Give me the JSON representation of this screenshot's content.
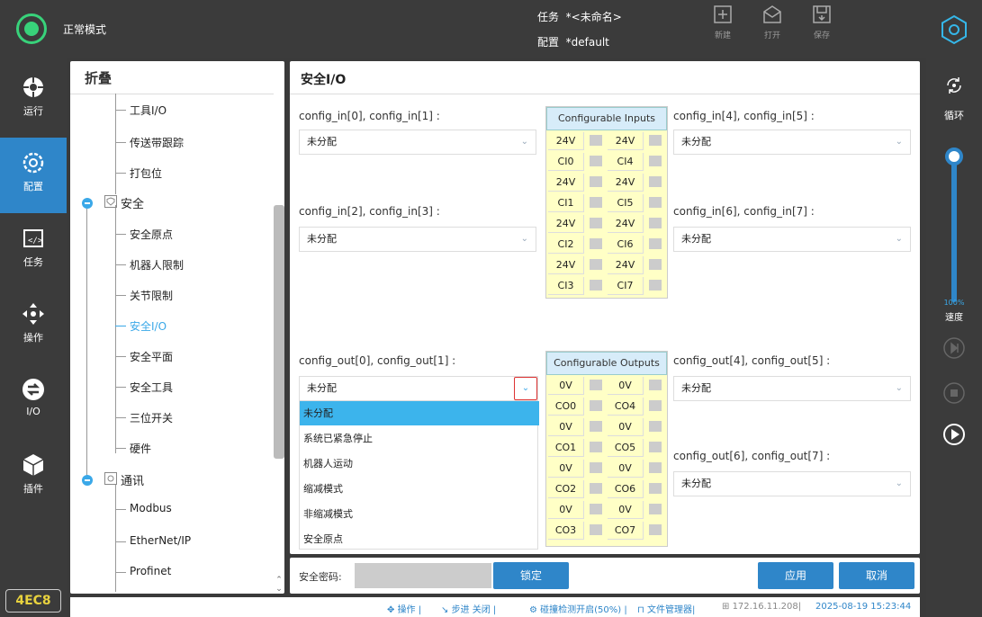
{
  "topbar": {
    "mode": "正常模式",
    "task_label": "任务",
    "task_value": "*<未命名>",
    "config_label": "配置",
    "config_value": "*default",
    "new_label": "新建",
    "open_label": "打开",
    "save_label": "保存"
  },
  "leftnav": {
    "items": [
      {
        "label": "运行",
        "icon": "run-icon"
      },
      {
        "label": "配置",
        "icon": "config-icon"
      },
      {
        "label": "任务",
        "icon": "task-icon"
      },
      {
        "label": "操作",
        "icon": "move-icon"
      },
      {
        "label": "I/O",
        "icon": "io-icon"
      },
      {
        "label": "插件",
        "icon": "plugin-icon"
      }
    ],
    "badge": "4EC8"
  },
  "rightbar": {
    "loop_label": "循环",
    "speed_value": "100%",
    "speed_label": "速度"
  },
  "tree": {
    "title": "折叠",
    "items": [
      "工具I/O",
      "传送带跟踪",
      "打包位",
      "安全",
      "安全原点",
      "机器人限制",
      "关节限制",
      "安全I/O",
      "安全平面",
      "安全工具",
      "三位开关",
      "硬件",
      "通讯",
      "Modbus",
      "EtherNet/IP",
      "Profinet"
    ]
  },
  "main": {
    "title": "安全I/O",
    "in_labels": [
      "config_in[0], config_in[1] :",
      "config_in[2], config_in[3] :",
      "config_in[4], config_in[5] :",
      "config_in[6], config_in[7] :"
    ],
    "out_labels": [
      "config_out[0], config_out[1] :",
      "config_out[4], config_out[5] :",
      "config_out[6], config_out[7] :"
    ],
    "unassigned": "未分配",
    "inputs_header": "Configurable Inputs",
    "outputs_header": "Configurable Outputs",
    "inputs_rows": [
      [
        "24V",
        "24V"
      ],
      [
        "CI0",
        "CI4"
      ],
      [
        "24V",
        "24V"
      ],
      [
        "CI1",
        "CI5"
      ],
      [
        "24V",
        "24V"
      ],
      [
        "CI2",
        "CI6"
      ],
      [
        "24V",
        "24V"
      ],
      [
        "CI3",
        "CI7"
      ]
    ],
    "outputs_rows": [
      [
        "0V",
        "0V"
      ],
      [
        "CO0",
        "CO4"
      ],
      [
        "0V",
        "0V"
      ],
      [
        "CO1",
        "CO5"
      ],
      [
        "0V",
        "0V"
      ],
      [
        "CO2",
        "CO6"
      ],
      [
        "0V",
        "0V"
      ],
      [
        "CO3",
        "CO7"
      ]
    ],
    "dropdown_options": [
      "未分配",
      "系统已紧急停止",
      "机器人运动",
      "缩减模式",
      "非缩减模式",
      "安全原点"
    ]
  },
  "footer": {
    "password_label": "安全密码:",
    "lock_label": "锁定",
    "apply_label": "应用",
    "cancel_label": "取消"
  },
  "status": {
    "operate": "操作",
    "step": "步进 关闭",
    "collision": "碰撞检测开启(50%)",
    "files": "文件管理器",
    "ip": "172.16.11.208",
    "datetime": "2025-08-19 15:23:44"
  },
  "colors": {
    "accent": "#2f86c9",
    "highlight": "#3cb4ec",
    "status_ok": "#38d27a",
    "io_bg": "#ffffc6"
  }
}
